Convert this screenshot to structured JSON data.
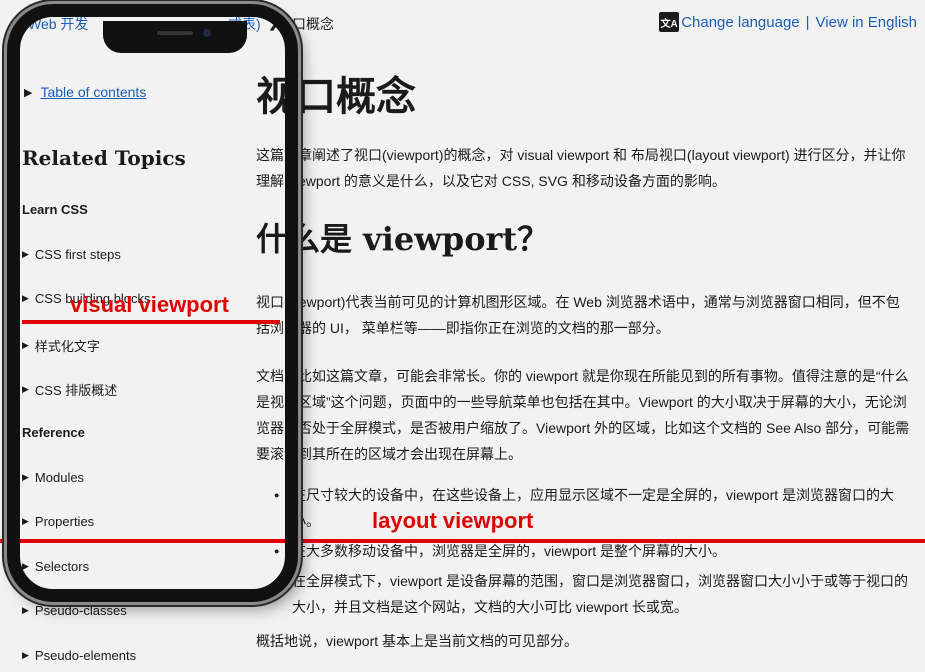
{
  "breadcrumb": {
    "left_text": "Web 开发",
    "mid_text": "式表)",
    "separator": "❯",
    "current": "口概念"
  },
  "language": {
    "icon_text": "文A",
    "change": "Change language",
    "separator": "|",
    "english": "View in English"
  },
  "sidebar": {
    "toc_label": "Table of contents",
    "related_title": "Related Topics",
    "group_learn": "Learn CSS",
    "learn_items": [
      "CSS first steps",
      "CSS building blocks",
      "样式化文字",
      "CSS 排版概述"
    ],
    "group_reference": "Reference",
    "reference_items": [
      "Modules",
      "Properties",
      "Selectors",
      "Pseudo-classes",
      "Pseudo-elements"
    ]
  },
  "main": {
    "title": "视口概念",
    "intro": "这篇文章阐述了视口(viewport)的概念，对 visual viewport 和 布局视口(layout viewport) 进行区分，并让你理解 viewport 的意义是什么，以及它对 CSS, SVG 和移动设备方面的影响。",
    "h2_prefix": "什么是 ",
    "h2_bold": "viewport？",
    "p1": "视口(viewport)代表当前可见的计算机图形区域。在 Web 浏览器术语中，通常与浏览器窗口相同，但不包括浏览器的 UI， 菜单栏等——即指你正在浏览的文档的那一部分。",
    "p2": "文档，比如这篇文章，可能会非常长。你的 viewport 就是你现在所能见到的所有事物。值得注意的是“什么是视口区域”这个问题，页面中的一些导航菜单也包括在其中。Viewport 的大小取决于屏幕的大小，无论浏览器是否处于全屏模式，是否被用户缩放了。Viewport 外的区域，比如这个文档的 See Also 部分，可能需要滚动到其所在的区域才会出现在屏幕上。",
    "bullets": [
      "在尺寸较大的设备中，在这些设备上，应用显示区域不一定是全屏的，viewport 是浏览器窗口的大小。",
      "在大多数移动设备中，浏览器是全屏的，viewport 是整个屏幕的大小。",
      "在全屏模式下，viewport 是设备屏幕的范围，窗口是浏览器窗口，浏览器窗口大小小于或等于视口的大小，并且文档是这个网站，文档的大小可比 viewport 长或宽。"
    ],
    "summary": "概括地说，viewport 基本上是当前文档的可见部分。"
  },
  "annotations": {
    "visual": "visual viewport",
    "layout": "layout viewport",
    "color": "#e00000"
  }
}
